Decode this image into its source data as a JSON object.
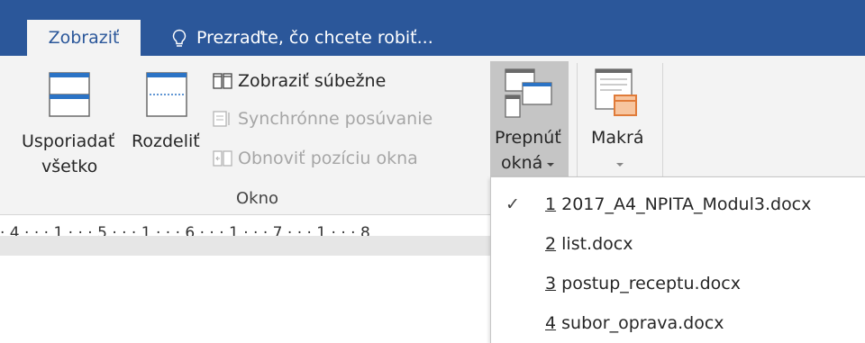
{
  "tabs": {
    "active": "Zobraziť"
  },
  "tell_me": {
    "text": "Prezraďte, čo chcete robiť..."
  },
  "ribbon": {
    "arrange_all": {
      "line1": "Usporiadať",
      "line2": "všetko"
    },
    "split": {
      "label": "Rozdeliť"
    },
    "view_side_by_side": "Zobraziť súbežne",
    "sync_scrolling": "Synchrónne posúvanie",
    "reset_window_position": "Obnoviť pozíciu okna",
    "switch_windows": {
      "line1": "Prepnúť",
      "line2": "okná"
    },
    "macros": {
      "label": "Makrá"
    },
    "group_label": "Okno"
  },
  "ruler": {
    "text": "· 4 · · · 1 · · · 5 · · · 1 · · · 6 · · · 1 · · · 7 · · · 1 · · · 8"
  },
  "dropdown": {
    "items": [
      {
        "num": "1",
        "name": " 2017_A4_NPITA_Modul3.docx",
        "checked": true
      },
      {
        "num": "2",
        "name": " list.docx",
        "checked": false
      },
      {
        "num": "3",
        "name": " postup_receptu.docx",
        "checked": false
      },
      {
        "num": "4",
        "name": " subor_oprava.docx",
        "checked": false
      }
    ],
    "check_symbol": "✓"
  },
  "colors": {
    "accent": "#2b579a",
    "ribbon_bg": "#f3f3f3",
    "pressed": "#c5c5c5"
  },
  "icons": [
    "lightbulb-icon",
    "arrange-all-icon",
    "split-icon",
    "side-by-side-icon",
    "sync-scroll-icon",
    "reset-window-icon",
    "switch-windows-icon",
    "macros-icon",
    "checkmark-icon"
  ]
}
